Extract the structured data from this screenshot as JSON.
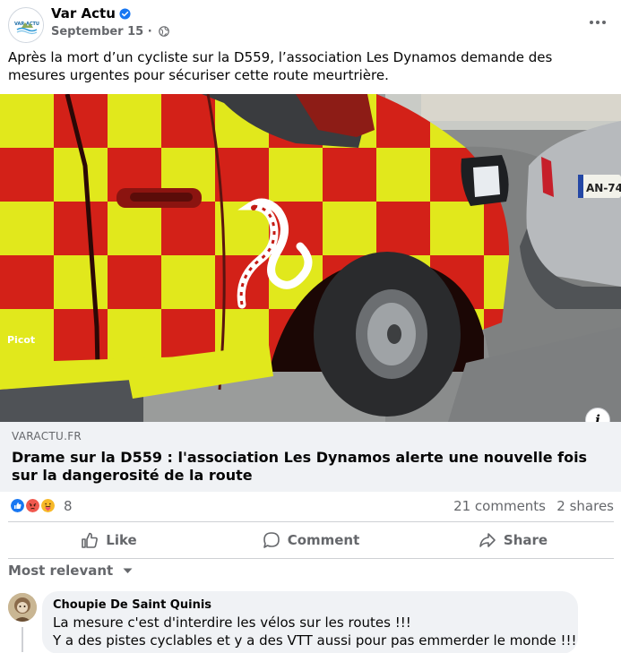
{
  "post": {
    "author": "Var Actu",
    "date": "September 15",
    "separator": "·",
    "avatar_label": "VAR ACTU",
    "text": "Après la mort d’un cycliste sur la D559, l’association Les Dynamos demande des mesures urgentes pour sécuriser cette route meurtrière.",
    "icons": {
      "verified": "verified-badge-icon",
      "audience": "globe-icon",
      "more": "more-options-icon"
    }
  },
  "photo": {
    "vehicle_text": "Picot",
    "plate": "AN-74",
    "info_label": "i"
  },
  "link": {
    "domain": "VARACTU.FR",
    "title": "Drame sur la D559 : l'association Les Dynamos alerte une nouvelle fois sur la dangerosité de la route"
  },
  "stats": {
    "reactions_count": "8",
    "comments": "21 comments",
    "shares": "2 shares",
    "reaction_types": [
      "like",
      "angry",
      "care"
    ],
    "colors": {
      "like": "#1877f2",
      "angry": "#f0584e",
      "care": "#f7b928"
    }
  },
  "actions": {
    "like": "Like",
    "comment": "Comment",
    "share": "Share"
  },
  "sort": {
    "label": "Most relevant"
  },
  "comments": [
    {
      "author": "Choupie De Saint Quinis",
      "line1": "La mesure c'est d'interdire les vélos sur les routes !!!",
      "line2": "Y a des pistes cyclables et y a des VTT aussi pour pas emmerder le monde !!!"
    }
  ]
}
